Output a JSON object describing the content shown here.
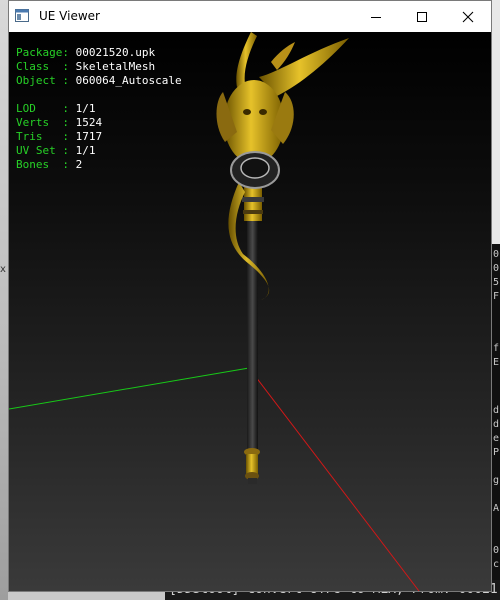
{
  "window": {
    "title": "UE Viewer",
    "controls": {
      "minimize": "minimize-icon",
      "maximize": "maximize-icon",
      "close": "close-icon"
    }
  },
  "info": {
    "package": {
      "label": "Package:",
      "value": "00021520.upk"
    },
    "class": {
      "label": "Class  :",
      "value": "SkeletalMesh"
    },
    "object": {
      "label": "Object :",
      "value": "060064_Autoscale"
    },
    "lod": {
      "label": "LOD    :",
      "value": "1/1"
    },
    "verts": {
      "label": "Verts  :",
      "value": "1524"
    },
    "tris": {
      "label": "Tris   :",
      "value": "1717"
    },
    "uvset": {
      "label": "UV Set :",
      "value": "1/1"
    },
    "bones": {
      "label": "Bones  :",
      "value": "2"
    }
  },
  "background_console": {
    "side_chars": [
      "0",
      "0",
      "5",
      "F",
      "",
      "",
      "f",
      "E",
      "",
      "d",
      "d",
      "e",
      "P",
      "g",
      "A",
      "",
      "0",
      "c"
    ],
    "bottom_line": "[DDStool] Convert UTF8 to MLX; From: 00021",
    "marker": "x"
  },
  "colors": {
    "label_green": "#27d127",
    "axis_x": "#d01818",
    "axis_y": "#18c818",
    "mesh_gold": "#c8a010"
  }
}
